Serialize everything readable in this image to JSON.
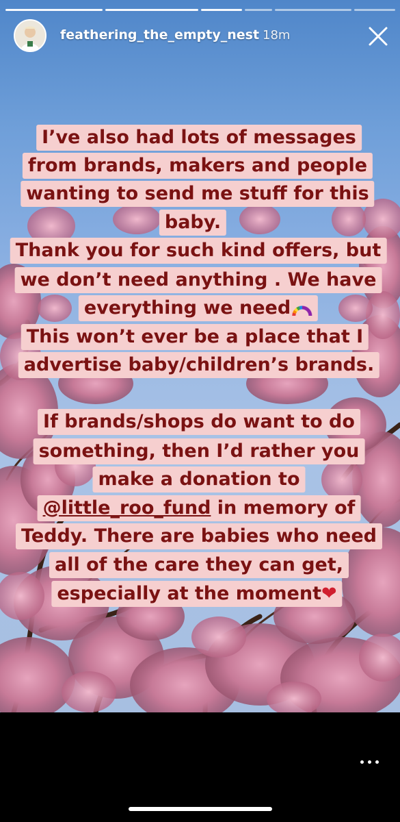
{
  "story": {
    "progress": [
      1,
      1,
      1,
      1,
      0.55,
      0
    ],
    "username": "feathering_the_empty_nest",
    "time": "18m"
  },
  "sticker": {
    "lines": [
      "I’ve also had lots of messages",
      "from brands, makers and people",
      "wanting to send me stuff for this",
      "baby.",
      "Thank you for such kind offers, but",
      "we don’t need anything . We have",
      "everything we need",
      "This won’t ever be a place that I",
      "advertise baby/children’s brands.",
      "If brands/shops do want to do",
      "something, then I’d rather you",
      "make a donation to",
      "@little_roo_fund",
      " in memory of",
      "Teddy. There are babies who need",
      "all of the care they can get,",
      "especially at the moment",
      "❤"
    ]
  },
  "icons": {
    "close": "close-icon",
    "rainbow": "rainbow-emoji-icon",
    "more": "more-options-icon"
  }
}
